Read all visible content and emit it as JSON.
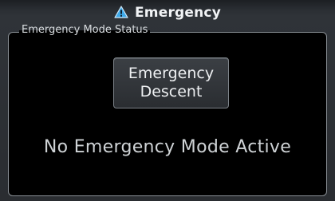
{
  "header": {
    "title": "Emergency",
    "icon": "warning-triangle-icon",
    "icon_color": "#3da8e8"
  },
  "panel": {
    "label": "Emergency Mode Status",
    "button": {
      "label": "Emergency\nDescent"
    },
    "status": "No Emergency Mode Active"
  }
}
